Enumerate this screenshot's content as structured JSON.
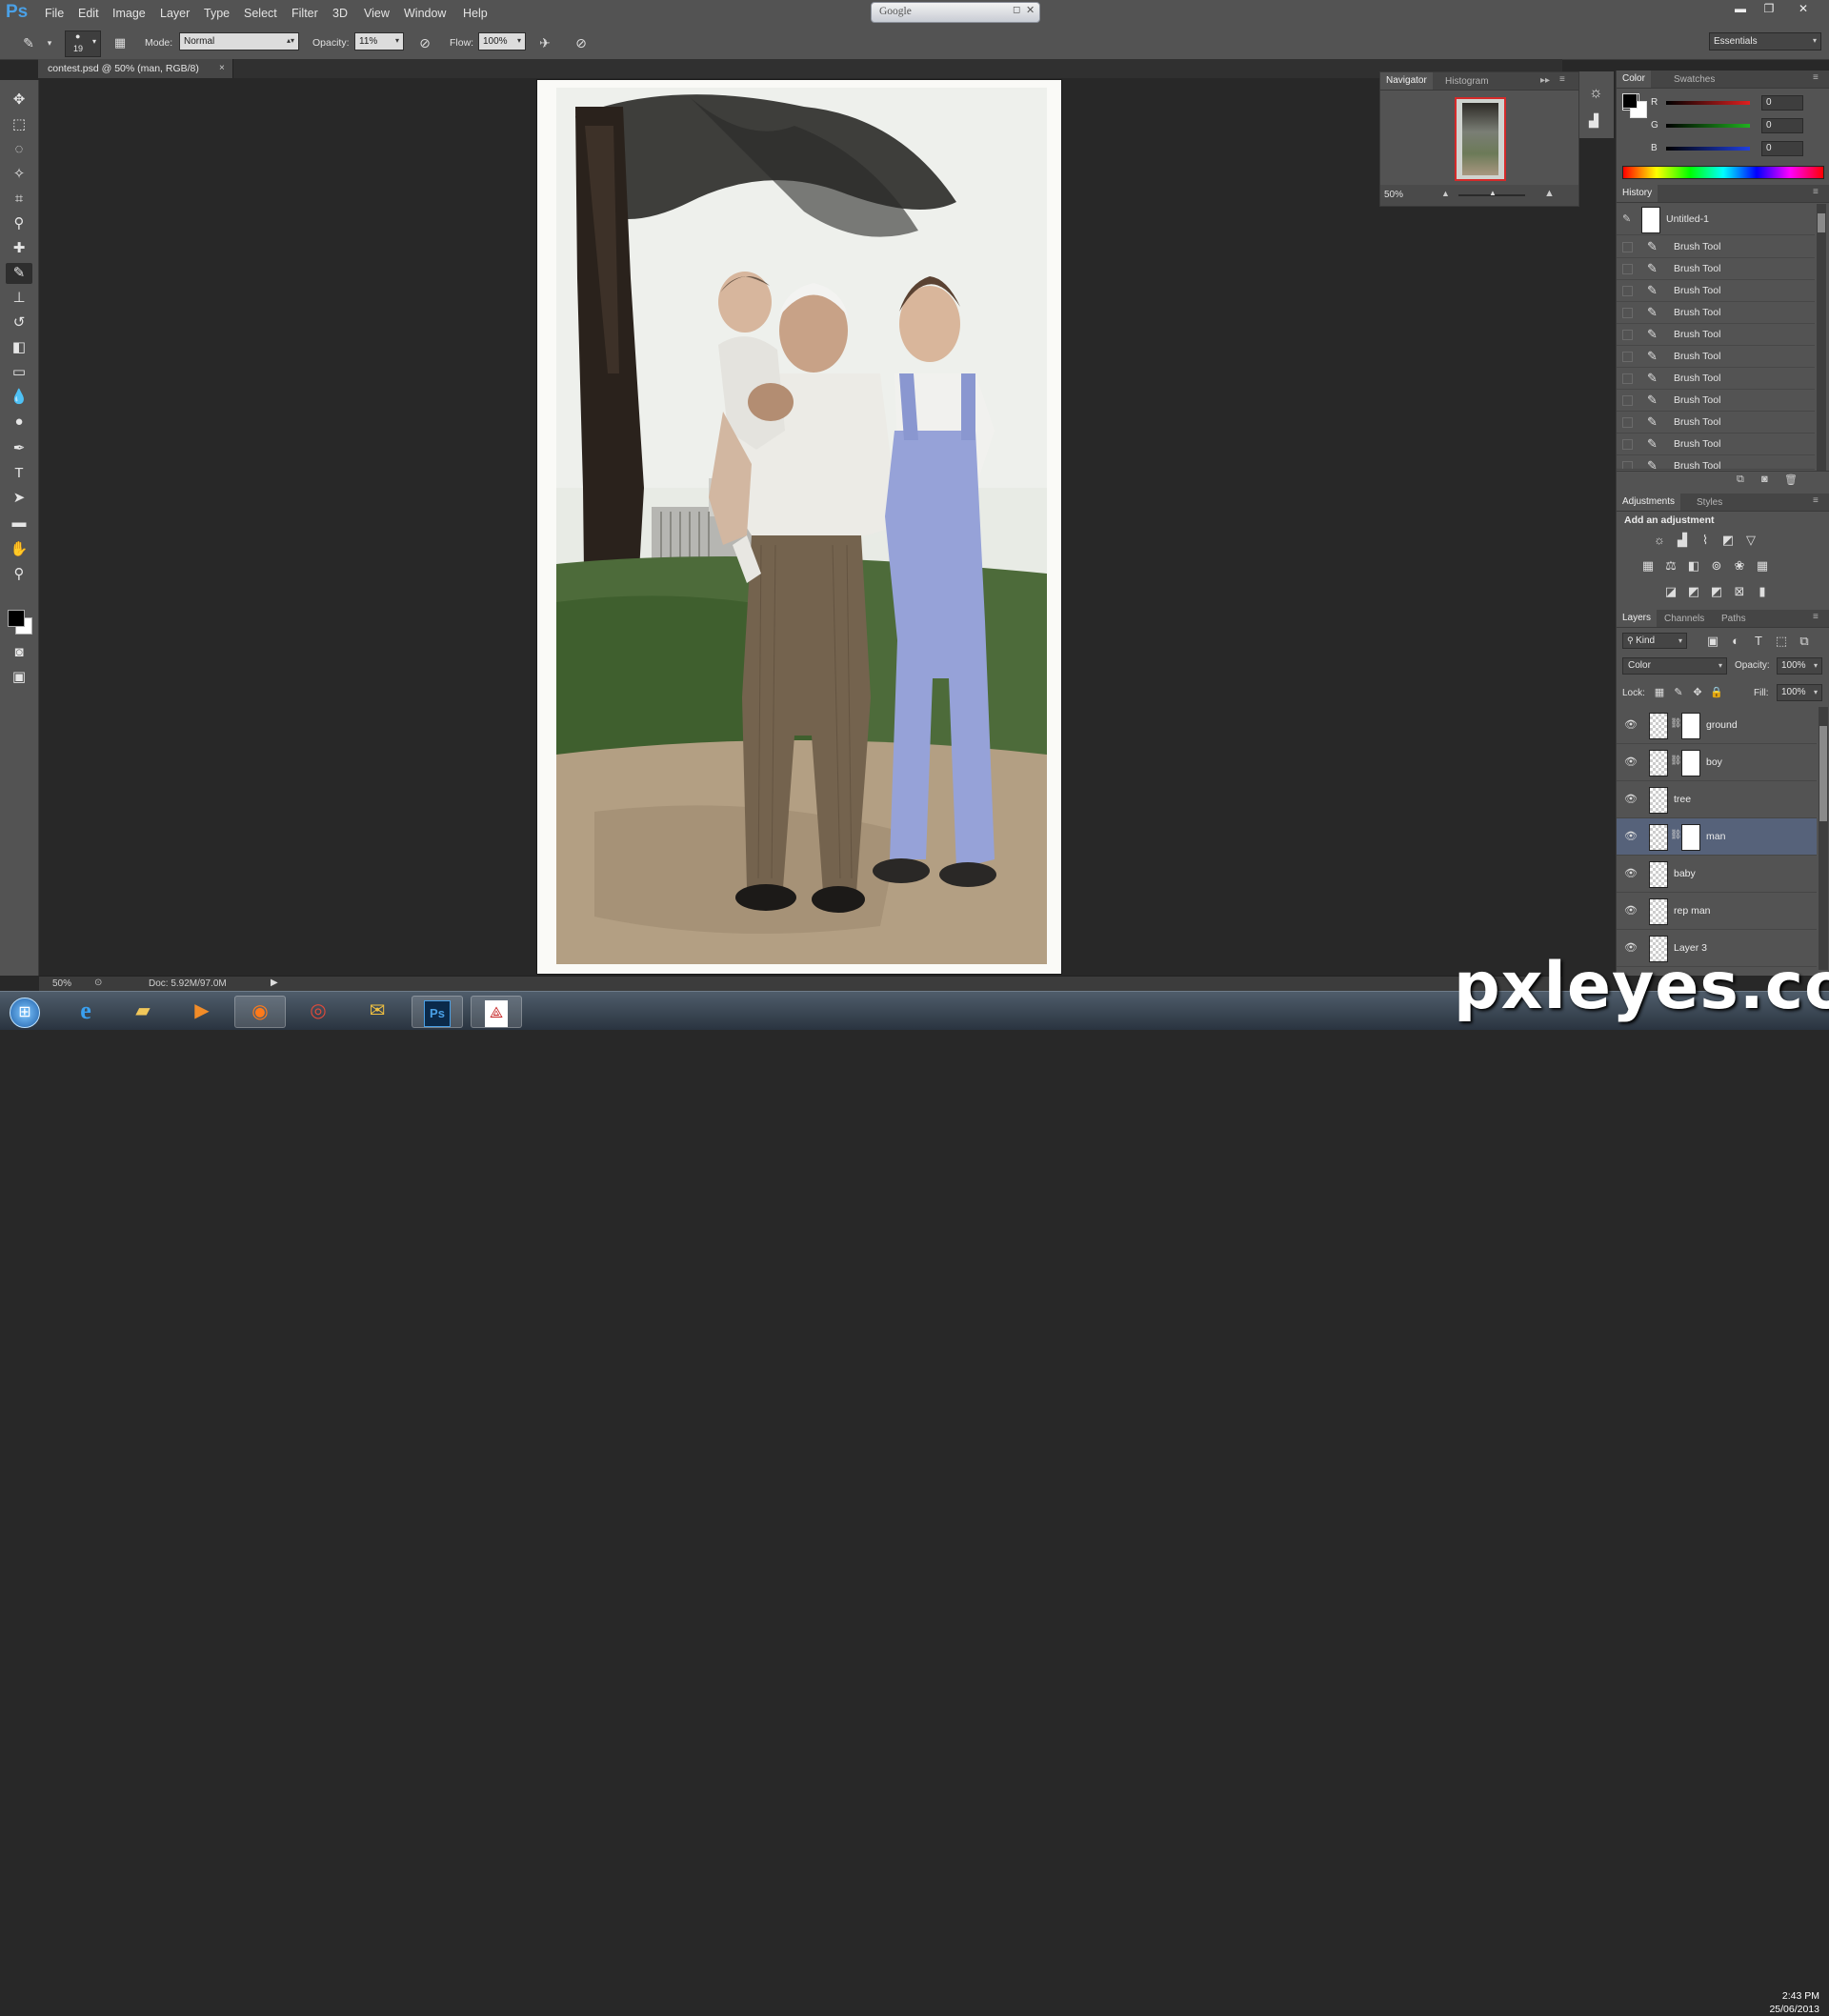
{
  "app": {
    "logo": "Ps"
  },
  "menubar": {
    "items": [
      "File",
      "Edit",
      "Image",
      "Layer",
      "Type",
      "Select",
      "Filter",
      "3D",
      "View",
      "Window",
      "Help"
    ],
    "search_tab": "Google",
    "workspace": "Essentials"
  },
  "options": {
    "brush_size": "19",
    "mode_label": "Mode:",
    "mode_value": "Normal",
    "opacity_label": "Opacity:",
    "opacity_value": "11%",
    "flow_label": "Flow:",
    "flow_value": "100%"
  },
  "document_tab": {
    "title": "contest.psd @ 50% (man, RGB/8)",
    "close": "×"
  },
  "status": {
    "zoom": "50%",
    "doc": "Doc: 5.92M/97.0M"
  },
  "navigator": {
    "tabs": [
      "Navigator",
      "Histogram"
    ],
    "zoom": "50%"
  },
  "color_panel": {
    "tabs": [
      "Color",
      "Swatches"
    ],
    "channels": [
      {
        "label": "R",
        "value": "0",
        "color": "#e02020"
      },
      {
        "label": "G",
        "value": "0",
        "color": "#20b020"
      },
      {
        "label": "B",
        "value": "0",
        "color": "#2040e0"
      }
    ]
  },
  "history": {
    "title": "History",
    "snapshot": "Untitled-1",
    "items": [
      "Brush Tool",
      "Brush Tool",
      "Brush Tool",
      "Brush Tool",
      "Brush Tool",
      "Brush Tool",
      "Brush Tool",
      "Brush Tool",
      "Brush Tool",
      "Brush Tool",
      "Brush Tool"
    ]
  },
  "adjustments": {
    "tabs": [
      "Adjustments",
      "Styles"
    ],
    "heading": "Add an adjustment"
  },
  "layers_panel": {
    "tabs": [
      "Layers",
      "Channels",
      "Paths"
    ],
    "filter": "Kind",
    "blend_mode": "Color",
    "opacity_label": "Opacity:",
    "opacity_value": "100%",
    "lock_label": "Lock:",
    "fill_label": "Fill:",
    "fill_value": "100%",
    "layers": [
      {
        "name": "ground",
        "mask": true,
        "selected": false
      },
      {
        "name": "boy",
        "mask": true,
        "selected": false
      },
      {
        "name": "tree",
        "mask": false,
        "selected": false
      },
      {
        "name": "man",
        "mask": true,
        "selected": true
      },
      {
        "name": "baby",
        "mask": false,
        "selected": false
      },
      {
        "name": "rep man",
        "mask": false,
        "selected": false
      },
      {
        "name": "Layer 3",
        "mask": false,
        "selected": false
      }
    ]
  },
  "taskbar": {
    "apps": [
      "start-orb",
      "internet-explorer",
      "file-explorer",
      "media-player",
      "firefox",
      "chrome",
      "outlook",
      "photoshop",
      "acrobat"
    ],
    "time": "2:43 PM",
    "date": "25/06/2013"
  },
  "watermark": "pxleyes.com"
}
